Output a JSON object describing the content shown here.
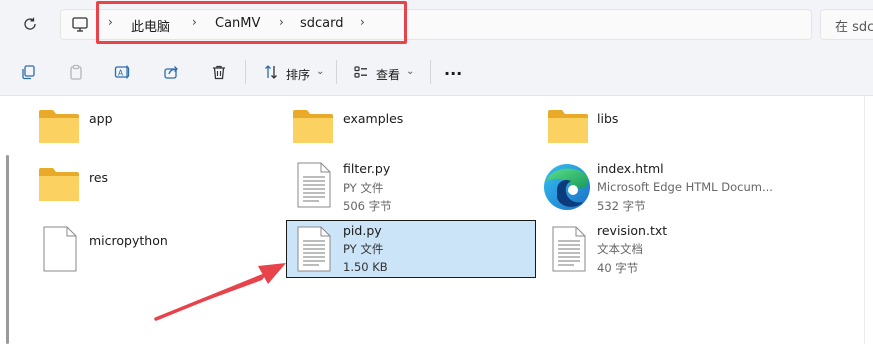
{
  "breadcrumb": {
    "items": [
      "此电脑",
      "CanMV",
      "sdcard"
    ]
  },
  "search": {
    "placeholder": "在 sdca"
  },
  "toolbar": {
    "sort_label": "排序",
    "view_label": "查看",
    "more_label": "..."
  },
  "files": [
    {
      "name": "app",
      "type": "folder"
    },
    {
      "name": "examples",
      "type": "folder"
    },
    {
      "name": "libs",
      "type": "folder"
    },
    {
      "name": "res",
      "type": "folder"
    },
    {
      "name": "filter.py",
      "type_label": "PY 文件",
      "size": "506 字节"
    },
    {
      "name": "index.html",
      "type_label": "Microsoft Edge HTML Docum...",
      "size": "532 字节"
    },
    {
      "name": "micropython",
      "type": "file"
    },
    {
      "name": "pid.py",
      "type_label": "PY 文件",
      "size": "1.50 KB"
    },
    {
      "name": "revision.txt",
      "type_label": "文本文档",
      "size": "40 字节"
    }
  ],
  "colors": {
    "highlight_box": "#e8424a",
    "selection_bg": "#cce4f7",
    "folder": "#f4c13d",
    "arrow": "#e8424a"
  }
}
